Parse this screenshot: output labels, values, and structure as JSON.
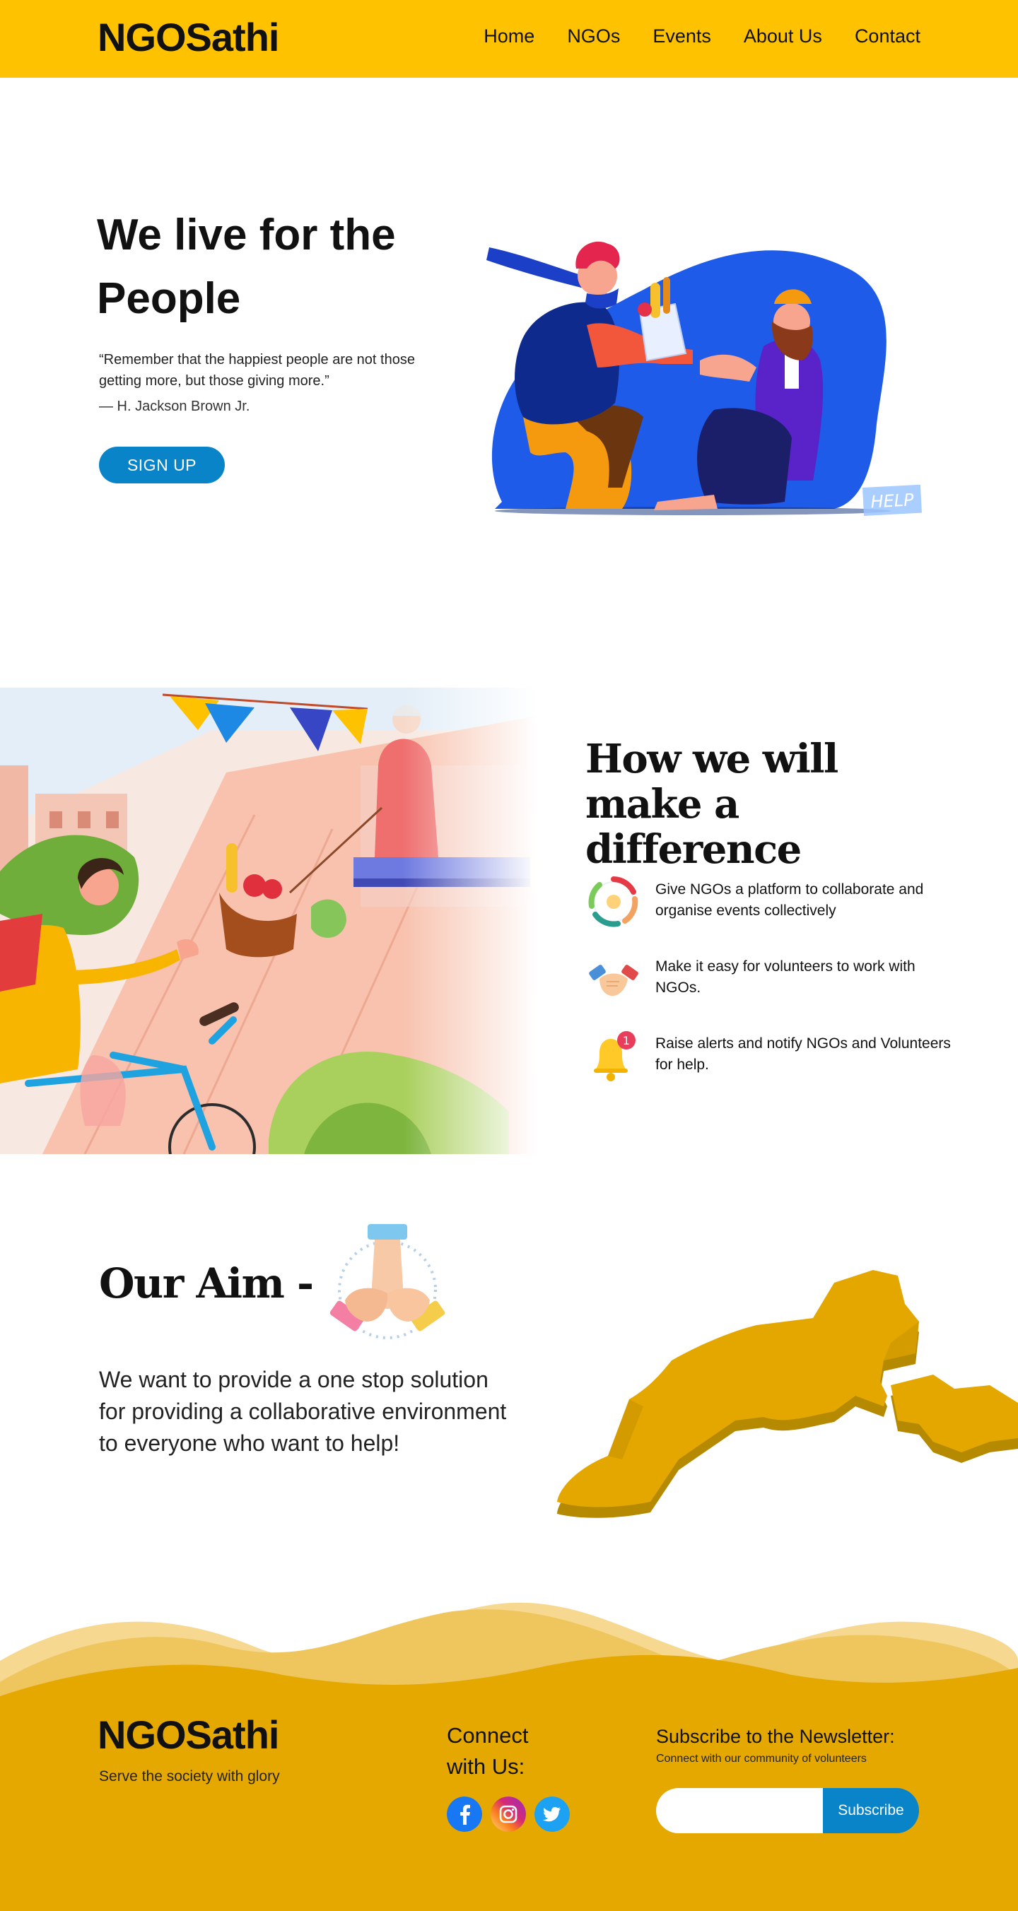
{
  "colors": {
    "nav_yellow": "#FFC200",
    "footer_gold": "#E5A800",
    "accent_blue": "#0A84C9"
  },
  "nav": {
    "brand": "NGOSathi",
    "links": [
      "Home",
      "NGOs",
      "Events",
      "About Us",
      "Contact"
    ]
  },
  "hero": {
    "title": "We live for the People",
    "quote": "“Remember that the happiest people are not those getting more, but those giving more.”",
    "author": "— H. Jackson Brown Jr.",
    "signup_label": "SIGN UP",
    "art_sign": "HELP"
  },
  "difference": {
    "title": "How we will make a difference",
    "features": [
      {
        "icon": "collaboration-circle-icon",
        "text": "Give  NGOs a platform to collaborate and organise events collectively"
      },
      {
        "icon": "handshake-icon",
        "text": "Make it easy for volunteers to work with NGOs."
      },
      {
        "icon": "notification-bell-icon",
        "text": "Raise alerts and notify NGOs and Volunteers for help.",
        "badge": "1"
      }
    ]
  },
  "aim": {
    "title": "Our Aim -",
    "text": "We want to provide a one stop solution for providing a collaborative environment to everyone who want to help!"
  },
  "footer": {
    "brand": "NGOSathi",
    "tagline": "Serve the society with glory",
    "connect_title": "Connect with Us:",
    "socials": [
      "facebook-icon",
      "instagram-icon",
      "twitter-icon"
    ],
    "newsletter_title": "Subscribe to the Newsletter:",
    "newsletter_sub": "Connect with our community of volunteers",
    "email_value": "",
    "subscribe_label": "Subscribe"
  }
}
